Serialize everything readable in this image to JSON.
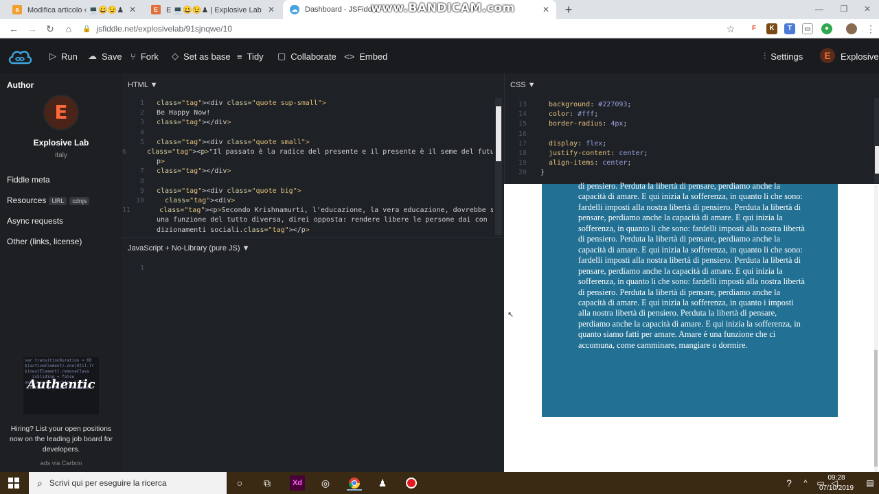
{
  "browser": {
    "tabs": [
      {
        "title": "Modifica articolo ‹ 💻😀😉♟",
        "favicon": "amazon-a",
        "color": "#f0a030"
      },
      {
        "title": "E 💻😀😉♟ | Explosive Lab Blog",
        "favicon": "E",
        "color": "#e0703a"
      },
      {
        "title": "Dashboard - JSFiddle -",
        "favicon": "cloud",
        "color": "#4aa3df"
      }
    ],
    "watermark": "www.BANDICAM.com",
    "url": "jsfiddle.net/explosivelab/91sjnqwe/10"
  },
  "header": {
    "run": "Run",
    "save": "Save",
    "fork": "Fork",
    "set_as_base": "Set as base",
    "tidy": "Tidy",
    "collaborate": "Collaborate",
    "embed": "Embed",
    "settings": "Settings",
    "user": "Explosive"
  },
  "sidebar": {
    "author_heading": "Author",
    "author_avatar_letter": "E",
    "author_name": "Explosive Lab",
    "author_location": "italy",
    "fiddle_meta": "Fiddle meta",
    "resources": "Resources",
    "resources_url": "URL",
    "resources_cdnjs": "cdnjs",
    "async_requests": "Async requests",
    "other": "Other (links, license)",
    "ad_logo": "Authentic",
    "ad_text": "Hiring? List your open positions now on the leading job board for developers.",
    "ad_via": "ads via Carbon"
  },
  "html_panel": {
    "label": "HTML ▼",
    "lines": [
      {
        "n": "1",
        "code": "<div class=\"quote sup-small\">"
      },
      {
        "n": "2",
        "code": "Be Happy Now!"
      },
      {
        "n": "3",
        "code": "</div>"
      },
      {
        "n": "4",
        "code": ""
      },
      {
        "n": "5",
        "code": "<div class=\"quote small\">"
      },
      {
        "n": "6",
        "code": "  <p>\"Il passato è la radice del presente e il presente è il seme del futuro.\"</"
      },
      {
        "n": "",
        "code": "p>"
      },
      {
        "n": "7",
        "code": "</div>"
      },
      {
        "n": "8",
        "code": ""
      },
      {
        "n": "9",
        "code": "<div class=\"quote big\">"
      },
      {
        "n": "10",
        "code": "  <div>"
      },
      {
        "n": "11",
        "code": "    <p>Secondo Krishnamurti, l'educazione, la vera educazione, dovrebbe svolgere"
      },
      {
        "n": "",
        "code": "una funzione del tutto diversa, direi opposta: rendere libere le persone dai con"
      },
      {
        "n": "",
        "code": "dizionamenti sociali.</p>"
      }
    ]
  },
  "js_panel": {
    "label": "JavaScript + No-Library (pure JS) ▼",
    "line1": "1"
  },
  "css_panel": {
    "label": "CSS ▼",
    "lines": [
      {
        "n": "13",
        "prop": "background",
        "val": "#227093"
      },
      {
        "n": "14",
        "prop": "color",
        "val": "#fff"
      },
      {
        "n": "15",
        "prop": "border-radius",
        "val": "4px"
      },
      {
        "n": "16",
        "prop": "",
        "val": ""
      },
      {
        "n": "17",
        "prop": "display",
        "val": "flex"
      },
      {
        "n": "18",
        "prop": "justify-content",
        "val": "center"
      },
      {
        "n": "19",
        "prop": "align-items",
        "val": "center"
      },
      {
        "n": "20",
        "prop": "}",
        "val": ""
      }
    ]
  },
  "result": {
    "box_color": "#227093",
    "text": "di pensiero. Perduta la libertà di pensare, perdiamo anche la capacità di amare. E qui inizia la sofferenza, in quanto li che sono: fardelli imposti alla nostra libertà di pensiero. Perduta la libertà di pensare, perdiamo anche la capacità di amare. E qui inizia la sofferenza, in quanto li che sono: fardelli imposti alla nostra libertà di pensiero. Perduta la libertà di pensare, perdiamo anche la capacità di amare. E qui inizia la sofferenza, in quanto li che sono: fardelli imposti alla nostra libertà di pensiero. Perduta la libertà di pensare, perdiamo anche la capacità di amare. E qui inizia la sofferenza, in quanto li che sono: fardelli imposti alla nostra libertà di pensiero. Perduta la libertà di pensare, perdiamo anche la capacità di amare. E qui inizia la sofferenza, in quanto i imposti alla nostra libertà di pensiero. Perduta la libertà di pensare, perdiamo anche la capacità di amare. E qui inizia la sofferenza, in quanto siamo fatti per amare. Amare è una funzione che ci accomuna, come camminare, mangiare o dormire."
  },
  "taskbar": {
    "search_placeholder": "Scrivi qui per eseguire la ricerca",
    "time": "09:28",
    "date": "07/10/2019"
  }
}
